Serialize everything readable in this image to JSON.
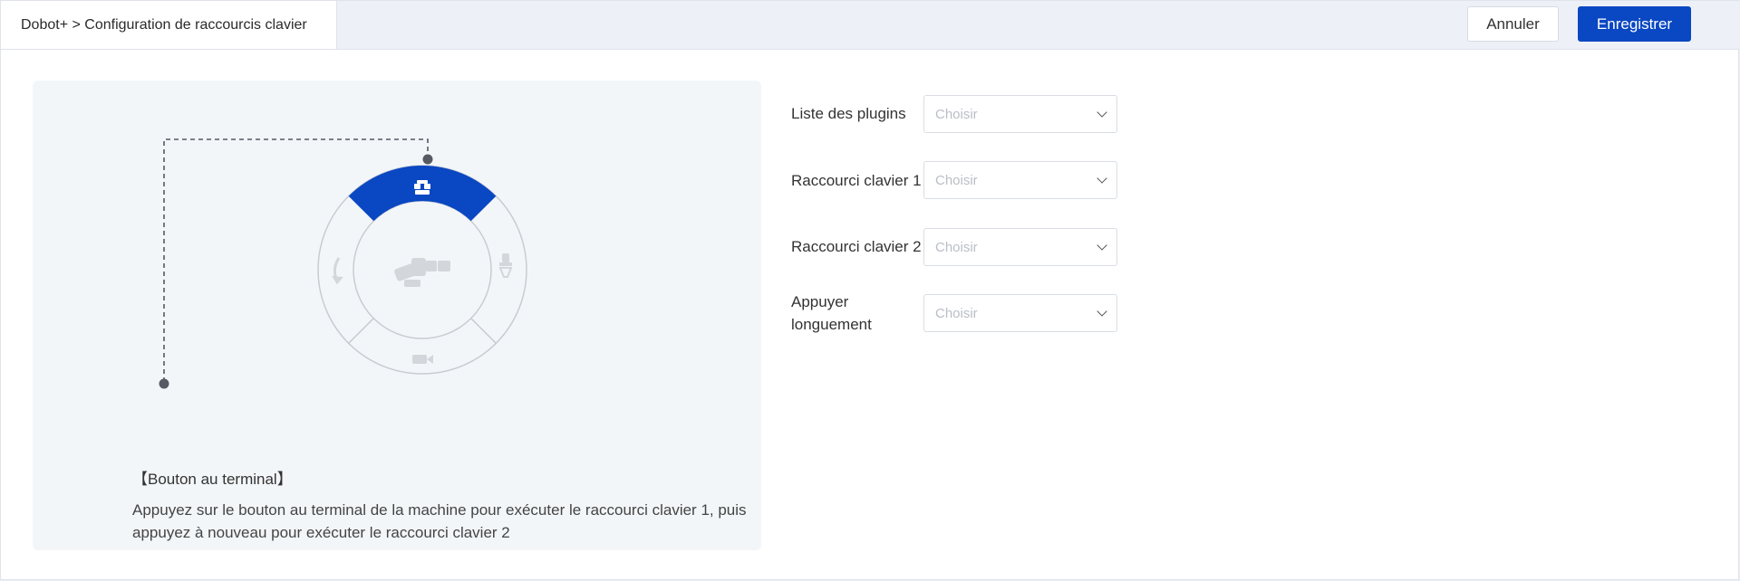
{
  "header": {
    "breadcrumb": "Dobot+ > Configuration de raccourcis clavier",
    "cancel_label": "Annuler",
    "save_label": "Enregistrer"
  },
  "illustration": {
    "caption_title": "【Bouton au terminal】",
    "caption_description": "Appuyez sur le bouton au terminal de la machine pour exécuter le raccourci clavier 1, puis appuyez à nouveau pour exécuter le raccourci clavier 2",
    "highlighted_segment": "top",
    "segment_icons": [
      "plugin-icon",
      "gripper-icon",
      "camera-icon",
      "rotate-icon"
    ],
    "center_icon": "robot-arm-icon",
    "colors": {
      "highlight": "#0a47c2",
      "outline": "#c8ccd2",
      "connector": "#555a63"
    }
  },
  "form": {
    "fields": [
      {
        "label": "Liste des plugins",
        "placeholder": "Choisir"
      },
      {
        "label": "Raccourci clavier 1",
        "placeholder": "Choisir"
      },
      {
        "label": "Raccourci clavier 2",
        "placeholder": "Choisir"
      },
      {
        "label": "Appuyer longuement",
        "placeholder": "Choisir"
      }
    ]
  },
  "colors": {
    "primary": "#0a47c2",
    "header_bg": "#edf1f7",
    "panel_bg": "#f3f6f9"
  }
}
